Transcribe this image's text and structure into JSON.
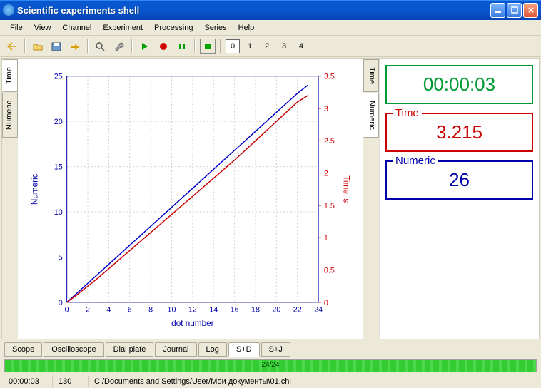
{
  "window": {
    "title": "Scientific experiments shell"
  },
  "menu": {
    "file": "File",
    "view": "View",
    "channel": "Channel",
    "experiment": "Experiment",
    "processing": "Processing",
    "series": "Series",
    "help": "Help"
  },
  "toolbar": {
    "numbers": {
      "n0": "0",
      "n1": "1",
      "n2": "2",
      "n3": "3",
      "n4": "4"
    }
  },
  "vtabs": {
    "time": "Time",
    "numeric": "Numeric"
  },
  "panels": {
    "clock": {
      "value": "00:00:03"
    },
    "time": {
      "label": "Time",
      "value": "3.215"
    },
    "numeric": {
      "label": "Numeric",
      "value": "26"
    }
  },
  "chart_data": {
    "type": "line",
    "title": "",
    "xlabel": "dot number",
    "ylabel_left": "Numeric",
    "ylabel_right": "Time, s",
    "xlim": [
      0,
      24
    ],
    "ylim_left": [
      0,
      25
    ],
    "ylim_right": [
      0,
      3.5
    ],
    "x_ticks": [
      0,
      2,
      4,
      6,
      8,
      10,
      12,
      14,
      16,
      18,
      20,
      22,
      24
    ],
    "y_ticks_left": [
      0,
      5,
      10,
      15,
      20,
      25
    ],
    "y_ticks_right": [
      0,
      0.5,
      1,
      1.5,
      2,
      2.5,
      3,
      3.5
    ],
    "series": [
      {
        "name": "Numeric",
        "axis": "left",
        "color": "#0000cc",
        "x": [
          0,
          1,
          2,
          3,
          4,
          5,
          6,
          7,
          8,
          9,
          10,
          11,
          12,
          13,
          14,
          15,
          16,
          17,
          18,
          19,
          20,
          21,
          22,
          23
        ],
        "y": [
          0,
          1.05,
          2.1,
          3.15,
          4.2,
          5.25,
          6.3,
          7.35,
          8.4,
          9.45,
          10.5,
          11.55,
          12.6,
          13.65,
          14.7,
          15.75,
          16.8,
          17.85,
          18.9,
          19.95,
          21,
          22.05,
          23.1,
          24
        ]
      },
      {
        "name": "Time",
        "axis": "right",
        "color": "#cc0000",
        "x": [
          0,
          1,
          2,
          3,
          4,
          5,
          6,
          7,
          8,
          9,
          10,
          11,
          12,
          13,
          14,
          15,
          16,
          17,
          18,
          19,
          20,
          21,
          22,
          23
        ],
        "y": [
          0,
          0.12,
          0.25,
          0.38,
          0.52,
          0.66,
          0.8,
          0.94,
          1.08,
          1.22,
          1.36,
          1.5,
          1.64,
          1.78,
          1.92,
          2.06,
          2.2,
          2.35,
          2.5,
          2.65,
          2.8,
          2.95,
          3.1,
          3.2
        ]
      }
    ]
  },
  "bottom_tabs": {
    "scope": "Scope",
    "oscilloscope": "Oscilloscope",
    "dialplate": "Dial plate",
    "journal": "Journal",
    "log": "Log",
    "sd": "S+D",
    "sj": "S+J"
  },
  "progress": {
    "text": "24/24"
  },
  "status": {
    "time": "00:00:03",
    "count": "130",
    "path": "C:/Documents and Settings/User/Мои документы\\01.chi"
  }
}
